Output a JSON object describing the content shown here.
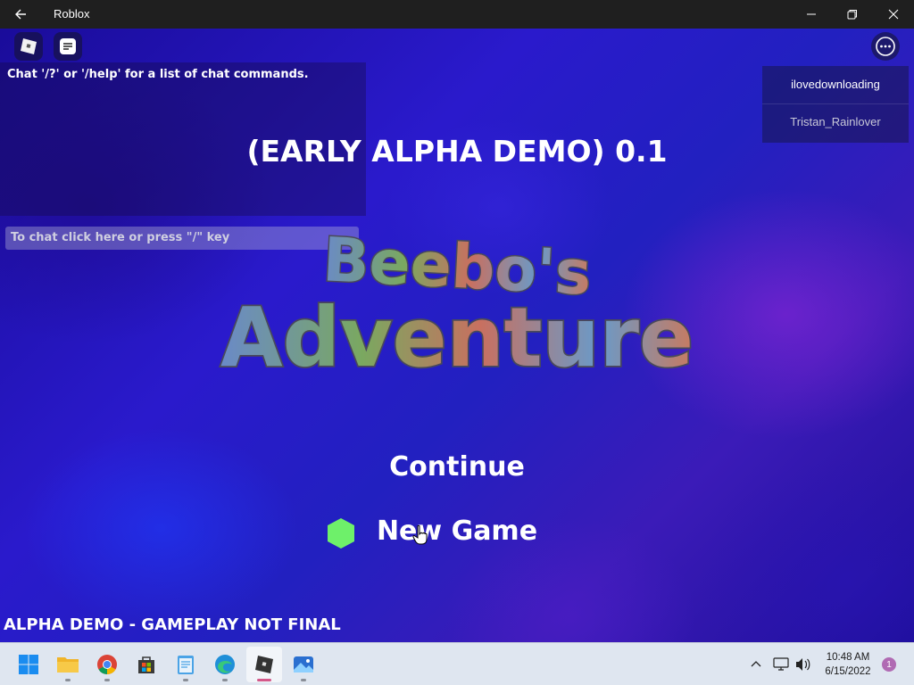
{
  "window": {
    "title": "Roblox"
  },
  "game": {
    "chat": {
      "system_message": "Chat '/?' or '/help' for a list of chat commands.",
      "input_placeholder": "To chat click here or press \"/\" key"
    },
    "players": [
      "ilovedownloading",
      "Tristan_Rainlover"
    ],
    "version_label": "(EARLY ALPHA DEMO) 0.1",
    "logo": {
      "line1": "Beebo's",
      "line2": "Adventure"
    },
    "menu": {
      "continue_label": "Continue",
      "new_game_label": "New Game"
    },
    "footer_note": "ALPHA DEMO - GAMEPLAY NOT FINAL"
  },
  "taskbar": {
    "apps": [
      "start-icon",
      "file-explorer-icon",
      "chrome-icon",
      "store-icon",
      "notepad-icon",
      "edge-icon",
      "roblox-icon",
      "photos-icon"
    ],
    "active_app": "roblox-icon",
    "clock": {
      "time": "10:48 AM",
      "date": "6/15/2022"
    },
    "notification_count": "1"
  },
  "colors": {
    "accent_hexagon": "#6ef06a",
    "active_app_indicator": "#d4588a"
  }
}
